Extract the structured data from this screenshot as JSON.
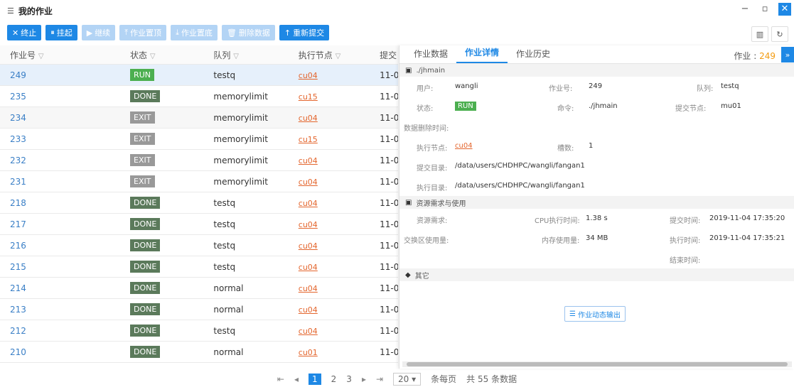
{
  "window": {
    "title": "我的作业",
    "controls": [
      "−",
      "▫",
      "✕"
    ]
  },
  "toolbar": [
    {
      "label": "终止",
      "icon": "✕",
      "enabled": true
    },
    {
      "label": "挂起",
      "icon": "⏸",
      "enabled": true
    },
    {
      "label": "继续",
      "icon": "▶",
      "enabled": false
    },
    {
      "label": "作业置顶",
      "icon": "⤒",
      "enabled": false
    },
    {
      "label": "作业置底",
      "icon": "⤓",
      "enabled": false
    },
    {
      "label": "删除数据",
      "icon": "🗑",
      "enabled": false
    },
    {
      "label": "重新提交",
      "icon": "↑",
      "enabled": true
    }
  ],
  "table": {
    "headers": [
      "作业号",
      "状态",
      "队列",
      "执行节点",
      "提交"
    ],
    "rows": [
      {
        "id": "249",
        "status": "RUN",
        "queue": "testq",
        "node": "cu04",
        "submit": "11-0"
      },
      {
        "id": "235",
        "status": "DONE",
        "queue": "memorylimit",
        "node": "cu15",
        "submit": "11-0"
      },
      {
        "id": "234",
        "status": "EXIT",
        "queue": "memorylimit",
        "node": "cu04",
        "submit": "11-0"
      },
      {
        "id": "233",
        "status": "EXIT",
        "queue": "memorylimit",
        "node": "cu15",
        "submit": "11-0"
      },
      {
        "id": "232",
        "status": "EXIT",
        "queue": "memorylimit",
        "node": "cu04",
        "submit": "11-0"
      },
      {
        "id": "231",
        "status": "EXIT",
        "queue": "memorylimit",
        "node": "cu04",
        "submit": "11-0"
      },
      {
        "id": "218",
        "status": "DONE",
        "queue": "testq",
        "node": "cu04",
        "submit": "11-0"
      },
      {
        "id": "217",
        "status": "DONE",
        "queue": "testq",
        "node": "cu04",
        "submit": "11-0"
      },
      {
        "id": "216",
        "status": "DONE",
        "queue": "testq",
        "node": "cu04",
        "submit": "11-0"
      },
      {
        "id": "215",
        "status": "DONE",
        "queue": "testq",
        "node": "cu04",
        "submit": "11-0"
      },
      {
        "id": "214",
        "status": "DONE",
        "queue": "normal",
        "node": "cu04",
        "submit": "11-0"
      },
      {
        "id": "213",
        "status": "DONE",
        "queue": "normal",
        "node": "cu04",
        "submit": "11-0"
      },
      {
        "id": "212",
        "status": "DONE",
        "queue": "testq",
        "node": "cu04",
        "submit": "11-0"
      },
      {
        "id": "210",
        "status": "DONE",
        "queue": "normal",
        "node": "cu01",
        "submit": "11-0"
      }
    ]
  },
  "pager": {
    "pages": [
      "1",
      "2",
      "3"
    ],
    "current": "1",
    "page_size": "20",
    "per_page_label": "条每页",
    "total": "共 55 条数据"
  },
  "panel": {
    "tabs": [
      "作业数据",
      "作业详情",
      "作业历史"
    ],
    "active_tab": "作业详情",
    "job_label": "作业 :",
    "job_number": "249",
    "section_main": "./jhmain",
    "user_label": "用户:",
    "user": "wangli",
    "jobid_label": "作业号:",
    "jobid": "249",
    "queue_label": "队列:",
    "queue": "testq",
    "status_label": "状态:",
    "status": "RUN",
    "cmd_label": "命令:",
    "cmd": "./jhmain",
    "submit_node_label": "提交节点:",
    "submit_node": "mu01",
    "delete_time_label": "数据删除时间:",
    "exec_node_label": "执行节点:",
    "exec_node": "cu04",
    "slots_label": "槽数:",
    "slots": "1",
    "submit_dir_label": "提交目录:",
    "submit_dir": "/data/users/CHDHPC/wangli/fangan1",
    "exec_dir_label": "执行目录:",
    "exec_dir": "/data/users/CHDHPC/wangli/fangan1",
    "section_res": "资源需求与使用",
    "res_req_label": "资源需求:",
    "cpu_label": "CPU执行时间:",
    "cpu": "1.38 s",
    "submit_time_label": "提交时间:",
    "submit_time": "2019-11-04 17:35:20",
    "swap_label": "交换区使用量:",
    "mem_label": "内存使用量:",
    "mem": "34 MB",
    "exec_time_label": "执行时间:",
    "exec_time": "2019-11-04 17:35:21",
    "end_time_label": "结束时间:",
    "section_other": "其它",
    "output_button": "作业动态输出"
  }
}
